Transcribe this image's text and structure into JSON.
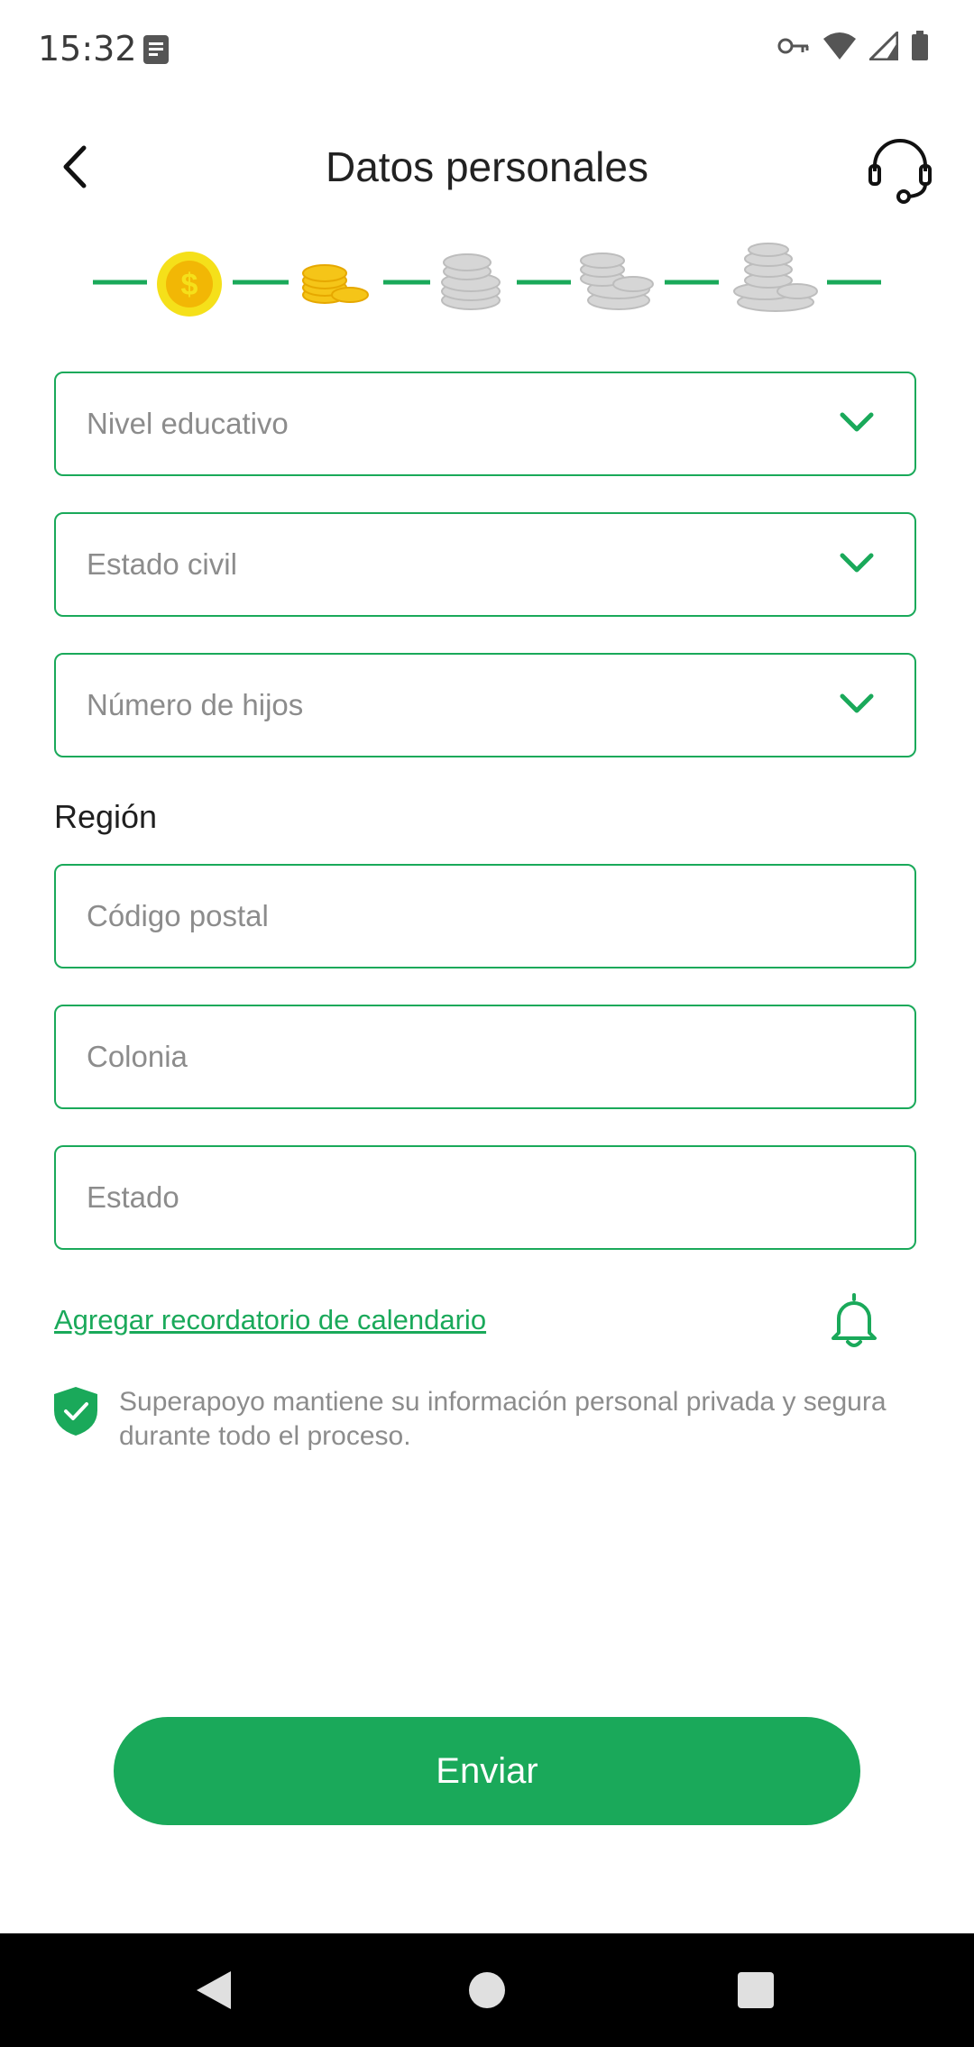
{
  "status_bar": {
    "time": "15:32"
  },
  "header": {
    "title": "Datos personales"
  },
  "progress": {
    "current_step": 1,
    "total_steps": 5
  },
  "fields": {
    "nivel_educativo": {
      "placeholder": "Nivel educativo"
    },
    "estado_civil": {
      "placeholder": "Estado civil"
    },
    "numero_hijos": {
      "placeholder": "Número de hijos"
    },
    "codigo_postal": {
      "placeholder": "Código postal"
    },
    "colonia": {
      "placeholder": "Colonia"
    },
    "estado": {
      "placeholder": "Estado"
    }
  },
  "region": {
    "label": "Región"
  },
  "calendar": {
    "link_text": "Agregar recordatorio de calendario"
  },
  "privacy": {
    "text": "Superapoyo mantiene su información personal privada y segura durante todo el proceso."
  },
  "submit": {
    "label": "Enviar"
  },
  "colors": {
    "accent": "#1aa95a",
    "coin_gold": "#f5c518",
    "coin_gray": "#cfcfcf"
  },
  "icons": [
    "back-arrow-icon",
    "headset-icon",
    "chevron-down-icon",
    "bell-icon",
    "shield-check-icon"
  ]
}
